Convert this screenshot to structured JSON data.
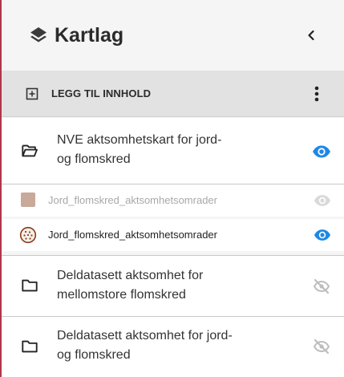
{
  "header": {
    "title": "Kartlag",
    "icon": "layers-icon",
    "collapse_icon": "chevron-left-icon"
  },
  "toolbar": {
    "add_label": "LEGG TIL INNHOLD",
    "add_icon": "plus-box-icon",
    "more_icon": "more-vertical-icon"
  },
  "layers": [
    {
      "label_line1": "NVE aktsomhetskart for jord-",
      "label_line2": "og flomskred",
      "icon": "folder-open-icon",
      "visible": true,
      "sublayers": [
        {
          "label": "Jord_flomskred_aktsomhetsomrader",
          "visible": false,
          "swatch_color": "#c9a99a",
          "symbol": "solid-swatch"
        },
        {
          "label": "Jord_flomskred_aktsomhetsomrader",
          "visible": true,
          "swatch_color": "#8b3a1a",
          "symbol": "dotted-circle"
        }
      ]
    },
    {
      "label_line1": "Deldatasett aktsomhet for",
      "label_line2": "mellomstore flomskred",
      "icon": "folder-icon",
      "visible": false
    },
    {
      "label_line1": "Deldatasett aktsomhet for jord-",
      "label_line2": "og flomskred",
      "icon": "folder-icon",
      "visible": false
    }
  ],
  "colors": {
    "accent": "#b0364b",
    "eye_on": "#1e88e5",
    "eye_off": "#bdbdbd",
    "text_muted": "#a8a8a8"
  }
}
